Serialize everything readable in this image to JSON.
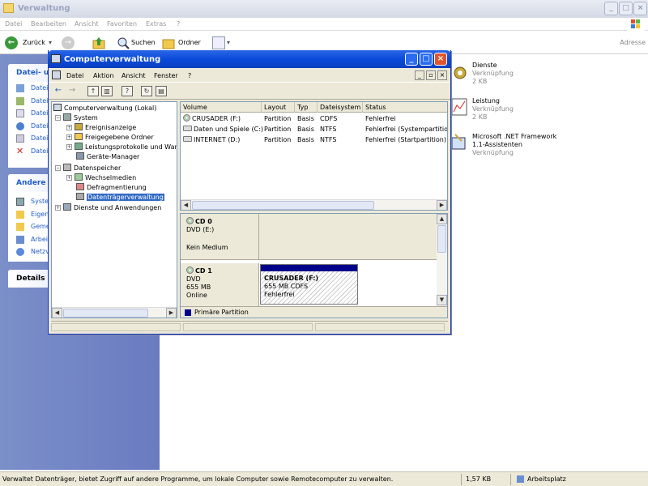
{
  "explorer": {
    "title": "Verwaltung",
    "menu": [
      "Datei",
      "Bearbeiten",
      "Ansicht",
      "Favoriten",
      "Extras",
      "?"
    ],
    "toolbar": {
      "back": "Zurück",
      "search": "Suchen",
      "folders": "Ordner",
      "address": "Adresse"
    },
    "taskpane": {
      "file_tasks_title": "Datei- un",
      "file_tasks": [
        "Datei",
        "Datei",
        "Datei",
        "Datei",
        "Datei",
        "Datei"
      ],
      "other_title": "Andere O",
      "other": [
        "Syste",
        "Eigen",
        "Geme",
        "Arbeit",
        "Netzv"
      ],
      "details_title": "Details"
    },
    "items": [
      {
        "name": "Dienste",
        "type": "Verknüpfung",
        "size": "2 KB"
      },
      {
        "name": "Leistung",
        "type": "Verknüpfung",
        "size": "2 KB"
      },
      {
        "name": "Microsoft .NET Framework",
        "name2": "1.1-Assistenten",
        "type": "Verknüpfung"
      }
    ],
    "status": {
      "text": "Verwaltet Datenträger, bietet Zugriff auf andere Programme, um lokale Computer sowie Remotecomputer zu verwalten.",
      "size": "1,57 KB",
      "location": "Arbeitsplatz"
    }
  },
  "cv": {
    "title": "Computerverwaltung",
    "menu": [
      "Datei",
      "Aktion",
      "Ansicht",
      "Fenster",
      "?"
    ],
    "tree": {
      "root": "Computerverwaltung (Lokal)",
      "system": "System",
      "events": "Ereignisanzeige",
      "shared": "Freigegebene Ordner",
      "perf": "Leistungsprotokolle und Wan",
      "devmgr": "Geräte-Manager",
      "storage": "Datenspeicher",
      "removable": "Wechselmedien",
      "defrag": "Defragmentierung",
      "diskmgmt": "Datenträgerverwaltung",
      "services": "Dienste und Anwendungen"
    },
    "columns": [
      "Volume",
      "Layout",
      "Typ",
      "Dateisystem",
      "Status"
    ],
    "volumes": [
      {
        "volume": "CRUSADER (F:)",
        "layout": "Partition",
        "typ": "Basis",
        "fs": "CDFS",
        "status": "Fehlerfrei"
      },
      {
        "volume": "Daten und Spiele (C:)",
        "layout": "Partition",
        "typ": "Basis",
        "fs": "NTFS",
        "status": "Fehlerfrei (Systempartition)"
      },
      {
        "volume": "INTERNET (D:)",
        "layout": "Partition",
        "typ": "Basis",
        "fs": "NTFS",
        "status": "Fehlerfrei (Startpartition)"
      }
    ],
    "disks": [
      {
        "name": "CD 0",
        "line1": "DVD (E:)",
        "line3": "Kein Medium"
      },
      {
        "name": "CD 1",
        "line1": "DVD",
        "line2": "655 MB",
        "line3": "Online",
        "part_name": "CRUSADER  (F:)",
        "part_size": "655 MB CDFS",
        "part_status": "Fehlerfrei"
      }
    ],
    "legend": "Primäre Partition",
    "legend_color": "#00008b"
  }
}
